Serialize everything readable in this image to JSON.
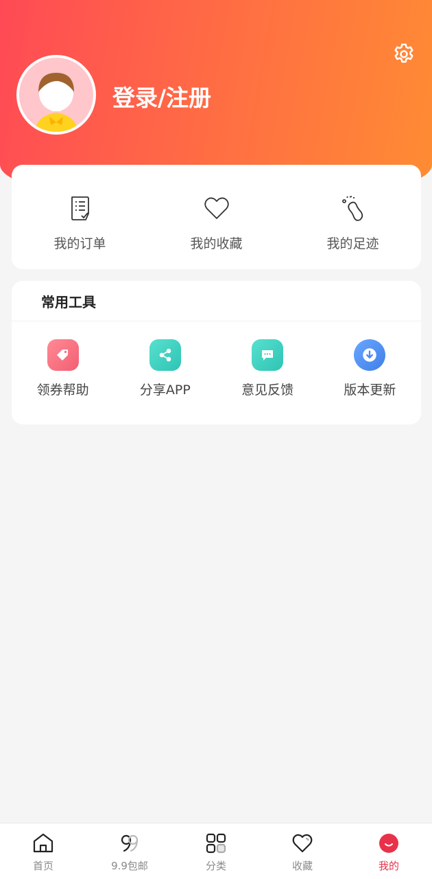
{
  "header": {
    "login_label": "登录/注册",
    "accent_start": "#ff4a55",
    "accent_end": "#ff8c33"
  },
  "quick_actions": [
    {
      "label": "我的订单",
      "icon": "order-list-icon"
    },
    {
      "label": "我的收藏",
      "icon": "heart-icon"
    },
    {
      "label": "我的足迹",
      "icon": "footprint-icon"
    }
  ],
  "tools": {
    "title": "常用工具",
    "items": [
      {
        "label": "领券帮助",
        "icon": "tag-icon",
        "color": "#f9707f"
      },
      {
        "label": "分享APP",
        "icon": "share-icon",
        "color": "#3fd3c2"
      },
      {
        "label": "意见反馈",
        "icon": "message-icon",
        "color": "#3fd3c2"
      },
      {
        "label": "版本更新",
        "icon": "download-icon",
        "color": "#4a8df5"
      }
    ]
  },
  "tabbar": {
    "items": [
      {
        "label": "首页",
        "icon": "home-icon"
      },
      {
        "label": "9.9包邮",
        "icon": "nine-nine-icon"
      },
      {
        "label": "分类",
        "icon": "grid-icon"
      },
      {
        "label": "收藏",
        "icon": "heart-icon"
      },
      {
        "label": "我的",
        "icon": "profile-icon"
      }
    ],
    "active_index": 4,
    "active_color": "#e8324a"
  }
}
